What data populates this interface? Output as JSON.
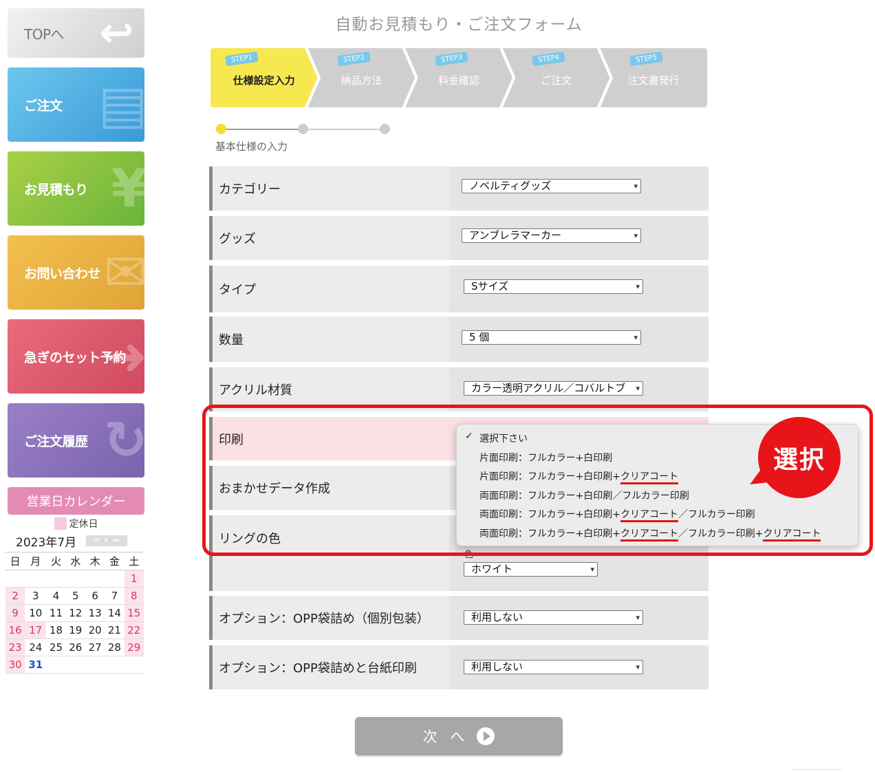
{
  "sidebar": {
    "top_label": "TOPへ",
    "order_label": "ご注文",
    "estimate_label": "お見積もり",
    "contact_label": "お問い合わせ",
    "urgent_label": "急ぎのセット予約",
    "history_label": "ご注文履歴"
  },
  "calendar": {
    "title": "営業日カレンダー",
    "legend": "定休日",
    "month": "2023年7月",
    "nav": "⏮ ⏸ ⏭",
    "weekdays": [
      "日",
      "月",
      "火",
      "水",
      "木",
      "金",
      "土"
    ],
    "weeks": [
      [
        "",
        "",
        "",
        "",
        "",
        "",
        "1"
      ],
      [
        "2",
        "3",
        "4",
        "5",
        "6",
        "7",
        "8"
      ],
      [
        "9",
        "10",
        "11",
        "12",
        "13",
        "14",
        "15"
      ],
      [
        "16",
        "17",
        "18",
        "19",
        "20",
        "21",
        "22"
      ],
      [
        "23",
        "24",
        "25",
        "26",
        "27",
        "28",
        "29"
      ],
      [
        "30",
        "31",
        "",
        "",
        "",
        "",
        ""
      ]
    ],
    "holidays": [
      "1",
      "2",
      "8",
      "9",
      "15",
      "16",
      "17",
      "22",
      "23",
      "29",
      "30"
    ],
    "today": "31"
  },
  "page_title": "自動お見積もり・ご注文フォーム",
  "steps": [
    {
      "tag": "STEP1",
      "label": "仕様設定入力"
    },
    {
      "tag": "STEP2",
      "label": "納品方法"
    },
    {
      "tag": "STEP3",
      "label": "料金確認"
    },
    {
      "tag": "STEP4",
      "label": "ご注文"
    },
    {
      "tag": "STEP5",
      "label": "注文書発行"
    }
  ],
  "progress_label": "基本仕様の入力",
  "form": {
    "category": {
      "label": "カテゴリー",
      "value": "ノベルティグッズ"
    },
    "goods": {
      "label": "グッズ",
      "value": "アンブレラマーカー"
    },
    "type": {
      "label": "タイプ",
      "value": "Sサイズ"
    },
    "quantity": {
      "label": "数量",
      "value": "5 個"
    },
    "acrylic": {
      "label": "アクリル材質",
      "value": "カラー透明アクリル／コバルトブ"
    },
    "print": {
      "label": "印刷"
    },
    "omakase": {
      "label": "おまかせデータ作成"
    },
    "ring": {
      "label": "リングの色",
      "color_caption": "色",
      "value": "ホワイト"
    },
    "opp": {
      "label": "オプション：OPP袋詰め（個別包装）",
      "value": "利用しない"
    },
    "opp_card": {
      "label": "オプション：OPP袋詰めと台紙印刷",
      "value": "利用しない"
    }
  },
  "print_dropdown": {
    "checkmark": "✓",
    "opt0": "選択下さい",
    "opt1": "片面印刷：フルカラー+白印刷",
    "opt2_a": "片面印刷：フルカラー+白印刷+",
    "opt2_b": "クリアコート",
    "opt3": "両面印刷：フルカラー+白印刷／フルカラー印刷",
    "opt4_a": "両面印刷：フルカラー+白印刷+",
    "opt4_b": "クリアコート",
    "opt4_c": "／フルカラー印刷",
    "opt5_a": "両面印刷：フルカラー+白印刷+",
    "opt5_b": "クリアコート",
    "opt5_c": "／フルカラー印刷+",
    "opt5_d": "クリアコート"
  },
  "callout": "選択",
  "next_button": "次 へ",
  "colors": {
    "step_active": "#f7e84f",
    "step_inactive": "#cfcfcf",
    "highlight": "#e8141a",
    "active_row": "#fae0e2"
  }
}
